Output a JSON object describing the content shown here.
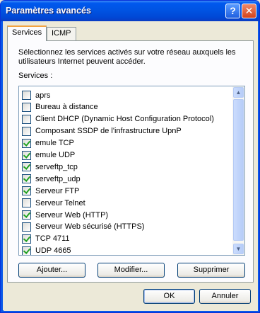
{
  "window": {
    "title": "Paramètres avancés",
    "help_glyph": "?",
    "close_glyph": "✕"
  },
  "tabs": [
    {
      "label": "Services",
      "active": true
    },
    {
      "label": "ICMP",
      "active": false
    }
  ],
  "panel": {
    "description": "Sélectionnez les services activés sur votre réseau auxquels les utilisateurs Internet peuvent accéder.",
    "services_label": "Services :"
  },
  "services": [
    {
      "label": "aprs",
      "checked": false
    },
    {
      "label": "Bureau à distance",
      "checked": false
    },
    {
      "label": "Client DHCP (Dynamic Host Configuration Protocol)",
      "checked": false
    },
    {
      "label": "Composant SSDP de l'infrastructure UpnP",
      "checked": false
    },
    {
      "label": "emule TCP",
      "checked": true
    },
    {
      "label": "emule UDP",
      "checked": true
    },
    {
      "label": "serveftp_tcp",
      "checked": true
    },
    {
      "label": "serveftp_udp",
      "checked": true
    },
    {
      "label": "Serveur FTP",
      "checked": true
    },
    {
      "label": "Serveur Telnet",
      "checked": false
    },
    {
      "label": "Serveur Web (HTTP)",
      "checked": true
    },
    {
      "label": "Serveur Web sécurisé (HTTPS)",
      "checked": false
    },
    {
      "label": "TCP 4711",
      "checked": true
    },
    {
      "label": "UDP 4665",
      "checked": true
    }
  ],
  "scrollbar": {
    "up_glyph": "▲",
    "down_glyph": "▼"
  },
  "list_buttons": {
    "add": "Ajouter...",
    "edit": "Modifier...",
    "delete": "Supprimer"
  },
  "dialog_buttons": {
    "ok": "OK",
    "cancel": "Annuler"
  },
  "colors": {
    "title_bar": "#0054e3",
    "close_button": "#d4431c",
    "checkmark": "#21a121",
    "tab_highlight": "#f2a341"
  }
}
